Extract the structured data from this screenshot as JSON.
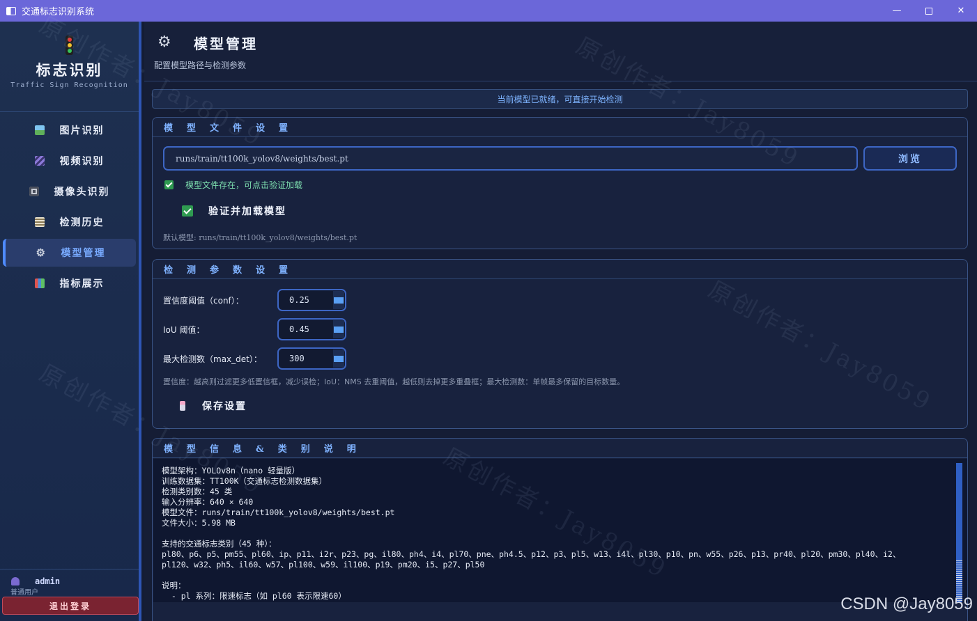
{
  "window": {
    "title": "交通标志识别系统",
    "controls": {
      "minimize": "—",
      "close": "✕"
    }
  },
  "sidebar": {
    "brand_title": "标志识别",
    "brand_subtitle": "Traffic Sign Recognition",
    "nav": [
      {
        "label": "图片识别",
        "icon": "image-icon",
        "active": false
      },
      {
        "label": "视频识别",
        "icon": "video-clapper-icon",
        "active": false
      },
      {
        "label": "摄像头识别",
        "icon": "camera-icon",
        "active": false
      },
      {
        "label": "检测历史",
        "icon": "clipboard-icon",
        "active": false
      },
      {
        "label": "模型管理",
        "icon": "gear-icon",
        "active": true
      },
      {
        "label": "指标展示",
        "icon": "bar-chart-icon",
        "active": false
      }
    ],
    "user": {
      "name": "admin",
      "role": "普通用户"
    },
    "logout_label": "退出登录"
  },
  "header": {
    "icon": "⚙",
    "title": "模型管理",
    "subtitle": "配置模型路径与检测参数"
  },
  "status_message": "当前模型已就绪，可直接开始检测",
  "model_file": {
    "group_title": "模型文件设置",
    "path_value": "runs/train/tt100k_yolov8/weights/best.pt",
    "browse_label": "浏览",
    "exists_message": "模型文件存在，可点击验证加载",
    "verify_label": "验证并加载模型",
    "default_model": "默认模型: runs/train/tt100k_yolov8/weights/best.pt"
  },
  "params": {
    "group_title": "检测参数设置",
    "conf_label": "置信度阈值（conf）：",
    "conf_value": "0.25",
    "iou_label": "IoU 阈值：",
    "iou_value": "0.45",
    "max_det_label": "最大检测数（max_det）：",
    "max_det_value": "300",
    "help": "置信度：越高则过滤更多低置信框，减少误检；IoU：NMS 去重阈值，越低则去掉更多重叠框；最大检测数：单帧最多保留的目标数量。",
    "save_label": "保存设置"
  },
  "model_info": {
    "group_title": "模型信息&类别说明",
    "text": "模型架构：YOLOv8n（nano 轻量版）\n训练数据集：TT100K（交通标志检测数据集）\n检测类别数：45 类\n输入分辨率：640 × 640\n模型文件：runs/train/tt100k_yolov8/weights/best.pt\n文件大小：5.98 MB\n\n支持的交通标志类别（45 种）：\npl80、p6、p5、pm55、pl60、ip、p11、i2r、p23、pg、il80、ph4、i4、pl70、pne、ph4.5、p12、p3、pl5、w13、i4l、pl30、p10、pn、w55、p26、p13、pr40、pl20、pm30、pl40、i2、\npl120、w32、ph5、il60、w57、pl100、w59、il100、p19、pm20、i5、p27、pl50\n\n说明：\n  - pl 系列：限速标志（如 pl60 表示限速60）\n  - p 系列：禁止标志"
  },
  "watermark": "原创作者：Jay8059",
  "footer_watermark": "CSDN @Jay8059"
}
